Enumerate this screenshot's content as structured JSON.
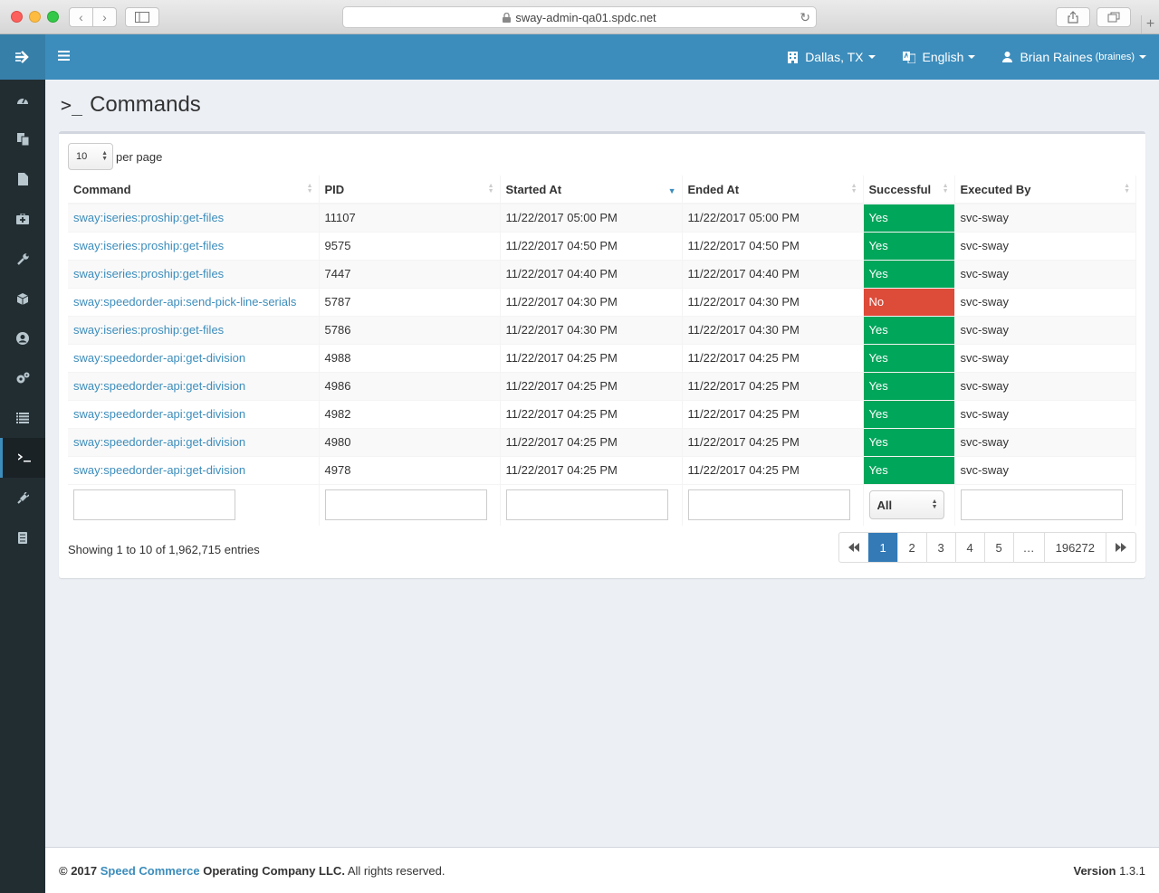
{
  "browser": {
    "url": "sway-admin-qa01.spdc.net"
  },
  "navbar": {
    "location": "Dallas, TX",
    "language": "English",
    "user_name": "Brian Raines",
    "user_handle": "(braines)"
  },
  "sidebar": {
    "items": [
      {
        "icon": "dashboard-icon"
      },
      {
        "icon": "copy-icon"
      },
      {
        "icon": "file-icon"
      },
      {
        "icon": "medkit-icon"
      },
      {
        "icon": "wrench-icon"
      },
      {
        "icon": "cube-icon"
      },
      {
        "icon": "user-circle-icon"
      },
      {
        "icon": "cogs-icon"
      },
      {
        "icon": "list-icon"
      },
      {
        "icon": "terminal-icon",
        "active": true
      },
      {
        "icon": "plug-icon"
      },
      {
        "icon": "database-icon"
      }
    ]
  },
  "page": {
    "title": "Commands",
    "per_page_value": "10",
    "per_page_label": "per page"
  },
  "table": {
    "columns": [
      "Command",
      "PID",
      "Started At",
      "Ended At",
      "Successful",
      "Executed By"
    ],
    "rows": [
      [
        "sway:iseries:proship:get-files",
        "11107",
        "11/22/2017 05:00 PM",
        "11/22/2017 05:00 PM",
        "Yes",
        "svc-sway"
      ],
      [
        "sway:iseries:proship:get-files",
        "9575",
        "11/22/2017 04:50 PM",
        "11/22/2017 04:50 PM",
        "Yes",
        "svc-sway"
      ],
      [
        "sway:iseries:proship:get-files",
        "7447",
        "11/22/2017 04:40 PM",
        "11/22/2017 04:40 PM",
        "Yes",
        "svc-sway"
      ],
      [
        "sway:speedorder-api:send-pick-line-serials",
        "5787",
        "11/22/2017 04:30 PM",
        "11/22/2017 04:30 PM",
        "No",
        "svc-sway"
      ],
      [
        "sway:iseries:proship:get-files",
        "5786",
        "11/22/2017 04:30 PM",
        "11/22/2017 04:30 PM",
        "Yes",
        "svc-sway"
      ],
      [
        "sway:speedorder-api:get-division",
        "4988",
        "11/22/2017 04:25 PM",
        "11/22/2017 04:25 PM",
        "Yes",
        "svc-sway"
      ],
      [
        "sway:speedorder-api:get-division",
        "4986",
        "11/22/2017 04:25 PM",
        "11/22/2017 04:25 PM",
        "Yes",
        "svc-sway"
      ],
      [
        "sway:speedorder-api:get-division",
        "4982",
        "11/22/2017 04:25 PM",
        "11/22/2017 04:25 PM",
        "Yes",
        "svc-sway"
      ],
      [
        "sway:speedorder-api:get-division",
        "4980",
        "11/22/2017 04:25 PM",
        "11/22/2017 04:25 PM",
        "Yes",
        "svc-sway"
      ],
      [
        "sway:speedorder-api:get-division",
        "4978",
        "11/22/2017 04:25 PM",
        "11/22/2017 04:25 PM",
        "Yes",
        "svc-sway"
      ]
    ],
    "successful_filter": "All"
  },
  "pagination": {
    "showing": "Showing 1 to 10 of 1,962,715 entries",
    "pages": [
      "1",
      "2",
      "3",
      "4",
      "5",
      "…",
      "196272"
    ],
    "active": "1"
  },
  "footer": {
    "copyright": "© 2017",
    "company_link": "Speed Commerce",
    "company_rest": "Operating Company LLC.",
    "rights": "All rights reserved.",
    "version_label": "Version",
    "version_value": "1.3.1"
  },
  "colors": {
    "brand": "#3c8dbc",
    "success": "#00a65a",
    "danger": "#dd4b39",
    "sidebar": "#222d32"
  }
}
